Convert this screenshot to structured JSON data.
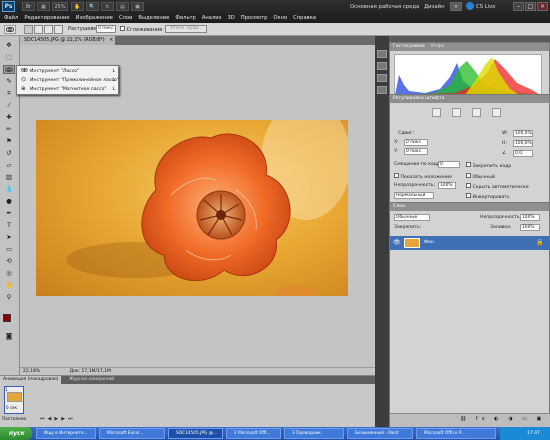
{
  "titlebar": {
    "logo": "Ps",
    "zoom": "25%",
    "workspace": "Основная рабочая среда",
    "design": "Дизайн",
    "cs_live": "CS Live",
    "more": "»"
  },
  "menu": [
    "Файл",
    "Редактирование",
    "Изображение",
    "Слои",
    "Выделение",
    "Фильтр",
    "Анализ",
    "3D",
    "Просмотр",
    "Окно",
    "Справка"
  ],
  "options": {
    "feather_label": "Растушевка:",
    "feather_value": "0 пикс.",
    "antialias_label": "Сглаживание",
    "refine_button": "Уточн. край..."
  },
  "document": {
    "tab_title": "SDC14505.JPG @ 22,2% (RGB/8*)",
    "zoom_status": "22,18%",
    "doc_status": "Док: 17,1M/17,1M"
  },
  "flyout": {
    "items": [
      {
        "label": "Инструмент \"Лассо\"",
        "key": "L",
        "active": true
      },
      {
        "label": "Инструмент \"Прямолинейное лассо\"",
        "key": "L",
        "active": false
      },
      {
        "label": "Инструмент \"Магнитное лассо\"",
        "key": "L",
        "active": false
      }
    ]
  },
  "histogram": {
    "tab_active": "Гистограмма",
    "tab_other": "Инфо"
  },
  "adjustments": {
    "title": "Регулировка штифта",
    "offset_label": "Сдвиг:",
    "x_label": "X:",
    "y_label": "Y:",
    "x_value": "0 пикс.",
    "y_value": "0 пикс.",
    "w_label": "W:",
    "h_label": "H:",
    "w_value": "100,0%",
    "h_value": "100,0%",
    "angle_value": "0,0",
    "snap_label": "Смещение по кадрам:",
    "snap_value": "0",
    "lock_label": "Закрепить кадр",
    "show_mask_label": "Показать наложение",
    "auto_hide_label": "Скрыть автоматически",
    "opacity_label": "Непрозрачность:",
    "opacity_value": "100%",
    "mode_value": "Нормальный",
    "normal_label": "Обычный",
    "extra_label": "Экстраполяция",
    "invert_label": "Инвертировать"
  },
  "layers": {
    "tab": "Слои",
    "blend": "Обычные",
    "opacity_label": "Непрозрачность:",
    "opacity_value": "100%",
    "lock_label": "Закрепить:",
    "fill_label": "Заливка:",
    "fill_value": "100%",
    "layer_name": "Фон"
  },
  "animation": {
    "tab_active": "Анимация (покадровая)",
    "tab_other": "Журнал измерений",
    "frame_number": "1",
    "frame_time": "0 сек.",
    "loop": "Постоянно"
  },
  "taskbar": {
    "start": "пуск",
    "tasks": [
      "Ищу в Интернете...",
      "Microsoft Excel...",
      "SDC14505.JPG @...",
      "2 Microsoft Offi...",
      "3 Проводник",
      "Безымянный - Paint",
      "Microsoft Office P..."
    ],
    "clock": "17:47"
  },
  "colors": {
    "foreground": "#8b0000",
    "background": "#ffffff",
    "accent": "#2b62c8"
  }
}
